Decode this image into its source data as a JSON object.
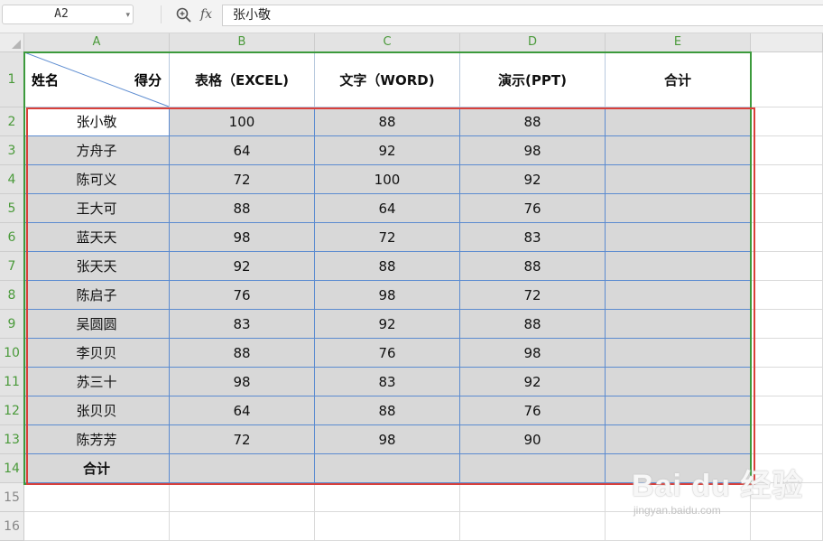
{
  "formula_bar": {
    "name_box": "A2",
    "fx_label": "fx",
    "formula": "张小敬"
  },
  "columns": [
    "A",
    "B",
    "C",
    "D",
    "E"
  ],
  "rows": [
    "1",
    "2",
    "3",
    "4",
    "5",
    "6",
    "7",
    "8",
    "9",
    "10",
    "11",
    "12",
    "13",
    "14",
    "15",
    "16"
  ],
  "header": {
    "a1_left": "姓名",
    "a1_right": "得分",
    "b1": "表格（EXCEL)",
    "c1": "文字（WORD)",
    "d1": "演示(PPT)",
    "e1": "合计"
  },
  "table": [
    {
      "name": "张小敬",
      "excel": "100",
      "word": "88",
      "ppt": "88",
      "total": ""
    },
    {
      "name": "方舟子",
      "excel": "64",
      "word": "92",
      "ppt": "98",
      "total": ""
    },
    {
      "name": "陈可义",
      "excel": "72",
      "word": "100",
      "ppt": "92",
      "total": ""
    },
    {
      "name": "王大可",
      "excel": "88",
      "word": "64",
      "ppt": "76",
      "total": ""
    },
    {
      "name": "蓝天天",
      "excel": "98",
      "word": "72",
      "ppt": "83",
      "total": ""
    },
    {
      "name": "张天天",
      "excel": "92",
      "word": "88",
      "ppt": "88",
      "total": ""
    },
    {
      "name": "陈启子",
      "excel": "76",
      "word": "98",
      "ppt": "72",
      "total": ""
    },
    {
      "name": "吴圆圆",
      "excel": "83",
      "word": "92",
      "ppt": "88",
      "total": ""
    },
    {
      "name": "李贝贝",
      "excel": "88",
      "word": "76",
      "ppt": "98",
      "total": ""
    },
    {
      "name": "苏三十",
      "excel": "98",
      "word": "83",
      "ppt": "92",
      "total": ""
    },
    {
      "name": "张贝贝",
      "excel": "64",
      "word": "88",
      "ppt": "76",
      "total": ""
    },
    {
      "name": "陈芳芳",
      "excel": "72",
      "word": "98",
      "ppt": "90",
      "total": ""
    },
    {
      "name": "合计",
      "excel": "",
      "word": "",
      "ppt": "",
      "total": ""
    }
  ],
  "watermark": {
    "main": "Bai du 经验",
    "sub": "jingyan.baidu.com"
  },
  "colors": {
    "selection_green": "#3c9a3c",
    "highlight_red": "#d9403a",
    "data_fill": "#d8d8d8",
    "grid_blue": "#5b8bd0"
  }
}
